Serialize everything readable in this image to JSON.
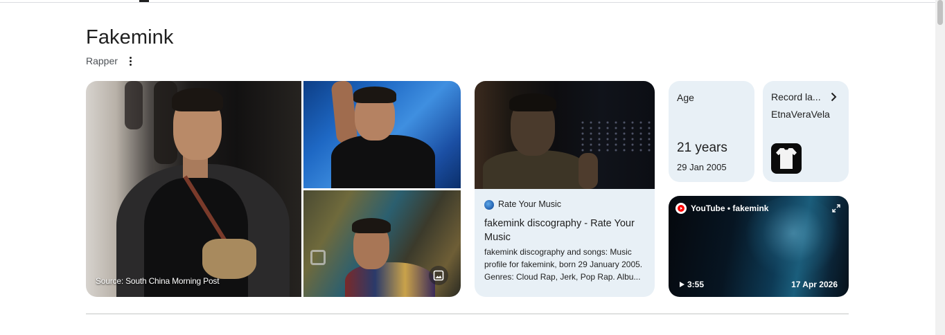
{
  "entity": {
    "title": "Fakemink",
    "subtitle": "Rapper",
    "more_icon": "more-vert-icon"
  },
  "collage": {
    "source_text": "Source: South China Morning Post",
    "image_search_icon": "image-search-icon"
  },
  "rym": {
    "source_name": "Rate Your Music",
    "title": "fakemink discography - Rate Your Music",
    "snippet": "fakemink discography and songs: Music profile for fakemink, born 29 January 2005. Genres: Cloud Rap, Jerk, Pop Rap. Albu..."
  },
  "age": {
    "label": "Age",
    "value": "21 years",
    "birth_date": "29 Jan 2005"
  },
  "record_label": {
    "label": "Record la...",
    "value": "EtnaVeraVela",
    "chevron_icon": "chevron-right-icon"
  },
  "youtube": {
    "source": "YouTube • fakemink",
    "duration": "3:55",
    "date": "17 Apr 2026",
    "logo_icon": "youtube-icon",
    "expand_icon": "expand-icon",
    "play_icon": "play-icon"
  },
  "colors": {
    "card_bg": "#e8f0f6",
    "text": "#1f1f1f",
    "secondary_text": "#4d5156",
    "youtube_red": "#ff0000"
  }
}
